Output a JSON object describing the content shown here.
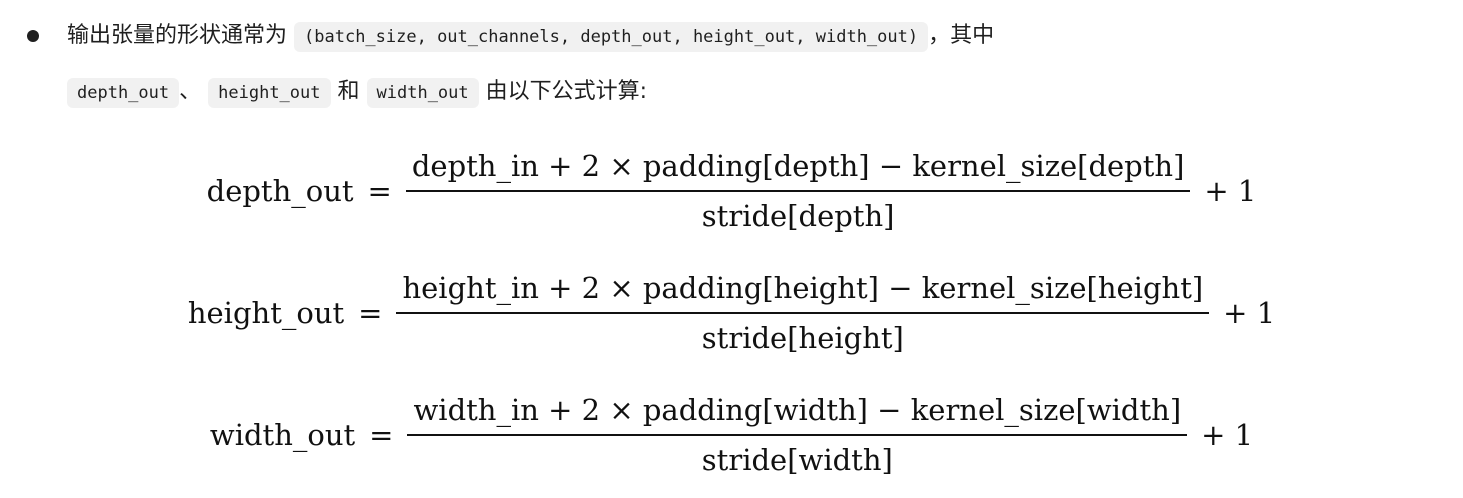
{
  "bullet": {
    "prefix": "输出张量的形状通常为",
    "shape_code": "(batch_size, out_channels, depth_out, height_out, width_out)",
    "after_shape": "，其中",
    "code_depth": "depth_out",
    "sep1": "、",
    "code_height": "height_out",
    "and_text": "和",
    "code_width": "width_out",
    "suffix": "由以下公式计算:"
  },
  "formulas": [
    {
      "lhs": "depth_out",
      "eq": "=",
      "numerator": "depth_in + 2 × padding[depth] − kernel_size[depth]",
      "denominator": "stride[depth]",
      "tail": "+ 1"
    },
    {
      "lhs": "height_out",
      "eq": "=",
      "numerator": "height_in + 2 × padding[height] − kernel_size[height]",
      "denominator": "stride[height]",
      "tail": "+ 1"
    },
    {
      "lhs": "width_out",
      "eq": "=",
      "numerator": "width_in + 2 × padding[width] − kernel_size[width]",
      "denominator": "stride[width]",
      "tail": "+ 1"
    }
  ]
}
